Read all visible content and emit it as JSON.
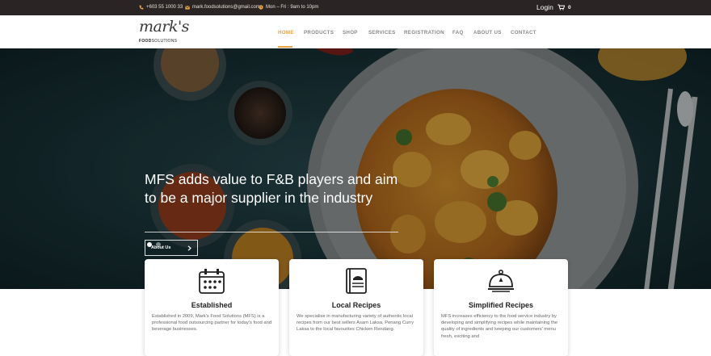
{
  "topbar": {
    "phone": "+603 55 1000 33",
    "email": "mark.foodsolutions@gmail.com",
    "hours": "Mon – Fri : 9am to 10pm",
    "login": "Login",
    "cart_count": "0"
  },
  "logo": {
    "script": "mark's",
    "sub_bold": "FOOD",
    "sub_rest": "SOLUTIONS"
  },
  "nav": {
    "items": [
      "HOME",
      "PRODUCTS",
      "SHOP",
      "SERVICES",
      "REGISTRATION",
      "FAQ",
      "ABOUT US",
      "CONTACT"
    ],
    "active": "HOME"
  },
  "hero": {
    "headline": "MFS adds value to F&B players and aim to be a major supplier in the industry",
    "button_label": "About Us",
    "slides": 2,
    "active_slide": 1
  },
  "cards": [
    {
      "title": "Established",
      "text": "Established in 2009, Mark's Food Solutions (MFS) is a professional food outsourcing partner for today's food and beverage businesses.",
      "icon": "calendar-icon"
    },
    {
      "title": "Local Recipes",
      "text": "We specialise in manufacturing variety of authentic local recipes from our best sellers Asam Laksa, Penang Curry Laksa to the local favourites Chicken Rendang.",
      "icon": "recipe-book-icon"
    },
    {
      "title": "Simplified Recipes",
      "text": "MFS increases efficiency to the food service industry by developing and simplifying recipes while maintaining the quality of ingredients and keeping our customers' menu fresh, exciting and",
      "icon": "food-cloche-icon"
    }
  ],
  "colors": {
    "accent": "#e8a44a",
    "topbar": "#2a2424",
    "hero_bg": "#1c3a40"
  }
}
